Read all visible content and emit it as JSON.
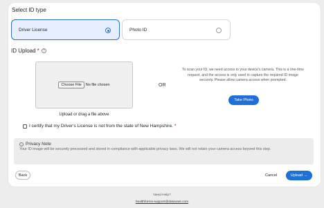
{
  "id_type": {
    "title": "Select ID type",
    "options": [
      {
        "label": "Driver License",
        "selected": true
      },
      {
        "label": "Photo ID",
        "selected": false
      }
    ]
  },
  "upload": {
    "title": "ID Upload",
    "required_mark": "*",
    "help_icon": "help-circle-icon",
    "choose_file_label": "Choose File",
    "no_file_text": "No file chosen",
    "caption": "Upload or drag a file above",
    "or_label": "OR",
    "camera_text": "To scan your ID, we need access to your device's camera. This is a one-time request, and the access is only used to capture the required ID image securely. Please allow camera access when prompted.",
    "take_photo_label": "Take Photo"
  },
  "certify": {
    "label": "I certify that my Driver's License is not from the state of New Hampshire.",
    "required_mark": "*",
    "checked": false
  },
  "privacy": {
    "icon": "info-icon",
    "title": "Privacy Note",
    "body": "Your ID image will be securely processed and stored in compliance with applicable privacy laws. We will not retain your camera access beyond this step."
  },
  "actions": {
    "back_label": "Back",
    "cancel_label": "Cancel",
    "upload_label": "Upload →"
  },
  "footer": {
    "help_text": "Need Help?",
    "support_email": "healthforms-support@datavant.com"
  },
  "colors": {
    "accent": "#1f6fd6",
    "selected_bg": "#e6efff",
    "required": "#d0021b",
    "page_bg": "#ededed"
  }
}
